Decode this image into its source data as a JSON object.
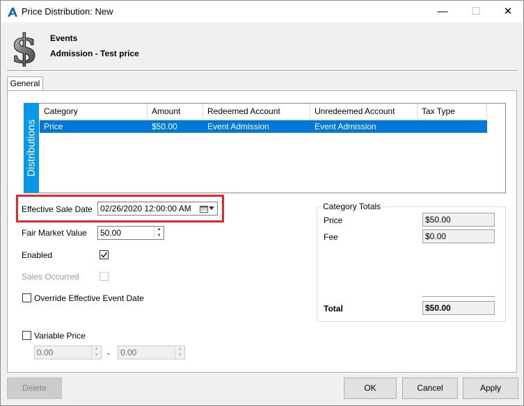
{
  "window": {
    "title": "Price Distribution: New",
    "minimize": "—",
    "maximize": "☐",
    "close": "✕"
  },
  "header": {
    "line1": "Events",
    "line2": "Admission - Test price"
  },
  "tabs": [
    {
      "label": "General",
      "active": true
    }
  ],
  "distributions": {
    "side_label": "Distributions",
    "columns": [
      "Category",
      "Amount",
      "Redeemed Account",
      "Unredeemed Account",
      "Tax Type"
    ],
    "rows": [
      {
        "category": "Price",
        "amount": "$50.00",
        "redeemed": "Event Admission",
        "unredeemed": "Event Admission",
        "tax_type": "",
        "selected": true
      }
    ]
  },
  "form": {
    "effective_sale_date_label": "Effective Sale Date",
    "effective_sale_date_value": "02/26/2020 12:00:00 AM",
    "fair_market_value_label": "Fair Market Value",
    "fair_market_value": "50.00",
    "enabled_label": "Enabled",
    "enabled_checked": true,
    "sales_occurred_label": "Sales Occurred",
    "sales_occurred_checked": false,
    "override_label": "Override Effective Event Date",
    "override_checked": false,
    "variable_price_label": "Variable Price",
    "variable_price_checked": false,
    "variable_min": "0.00",
    "variable_sep": "-",
    "variable_max": "0.00"
  },
  "category_totals": {
    "title": "Category Totals",
    "rows": [
      {
        "label": "Price",
        "value": "$50.00"
      },
      {
        "label": "Fee",
        "value": "$0.00"
      }
    ],
    "total_label": "Total",
    "total_value": "$50.00"
  },
  "buttons": {
    "delete": "Delete",
    "ok": "OK",
    "cancel": "Cancel",
    "apply": "Apply"
  },
  "colors": {
    "accent": "#0078d7",
    "side_label_bg": "#0a97e6",
    "highlight_box": "#e8262a"
  }
}
